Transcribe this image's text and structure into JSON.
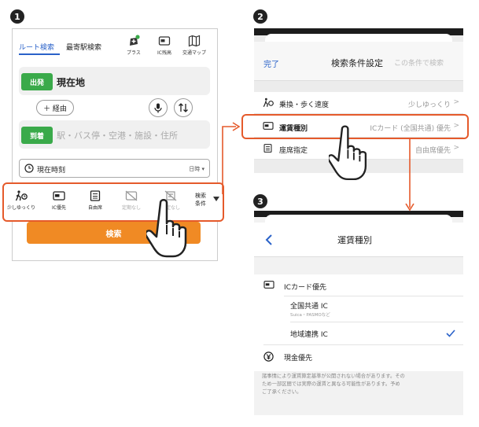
{
  "steps": [
    "1",
    "2",
    "3"
  ],
  "panel1": {
    "tabs": {
      "route": "ルート検索",
      "nearest": "最寄駅検索"
    },
    "tab_icons": [
      {
        "icon": "plus-spark-icon",
        "label": "プラス"
      },
      {
        "icon": "ic-card-icon",
        "label": "IC残高"
      },
      {
        "icon": "map-icon",
        "label": "交通マップ"
      }
    ],
    "depart": {
      "tag": "出発",
      "value": "現在地"
    },
    "via_label": "＋ 経由",
    "arrive": {
      "tag": "到着",
      "placeholder": "駅・バス停・空港・施設・住所"
    },
    "time": {
      "label": "現在時刻",
      "mode": "日時 ▾"
    },
    "options": [
      {
        "icon": "walk-speed-icon",
        "label": "少しゆっくり",
        "dim": false
      },
      {
        "icon": "ic-card-icon",
        "label": "IC優先",
        "dim": false
      },
      {
        "icon": "seat-icon",
        "label": "自由席",
        "dim": false
      },
      {
        "icon": "commuter-off-icon",
        "label": "定期なし",
        "dim": true
      },
      {
        "icon": "designated-off-icon",
        "label": "指定なし",
        "dim": true
      }
    ],
    "more": "検索\n条件",
    "search_button": "検索",
    "colors": {
      "accent": "#2a62c9",
      "depart": "#3aaa4a",
      "arrive": "#3aaa4a",
      "search": "#f08a24",
      "highlight": "#e55a2b"
    }
  },
  "panel2": {
    "done": "完了",
    "title": "検索条件設定",
    "search_with": "この条件で検索",
    "rows": [
      {
        "icon": "walk-speed-icon",
        "label": "乗換・歩く速度",
        "value": "少しゆっくり"
      },
      {
        "icon": "ic-card-icon",
        "label": "運賃種別",
        "value": "ICカード (全国共通) 優先"
      },
      {
        "icon": "seat-icon",
        "label": "座席指定",
        "value": "自由席優先"
      }
    ]
  },
  "panel3": {
    "title": "運賃種別",
    "ic_section": "ICカード優先",
    "options": [
      {
        "label": "全国共通 IC",
        "sub": "Suica・PASMOなど",
        "checked": false
      },
      {
        "label": "地域連携 IC",
        "sub": "",
        "checked": true
      }
    ],
    "cash": "現金優先",
    "note": "諸事情により運賃算定基準が公開されない場合があります。その\nため一部区間では実際の運賃と異なる可能性があります。予め\nご了承ください。"
  }
}
